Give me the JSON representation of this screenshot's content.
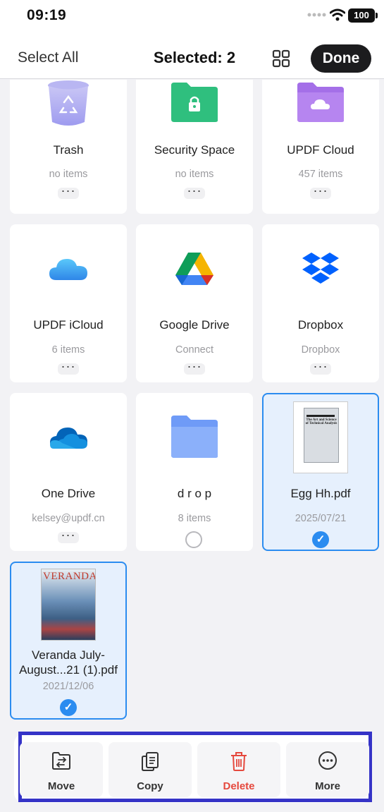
{
  "status_bar": {
    "time": "09:19",
    "battery": "100"
  },
  "nav": {
    "select_all": "Select All",
    "selected": "Selected: 2",
    "done": "Done"
  },
  "items": [
    {
      "name": "Trash",
      "sub": "no items",
      "icon": "trash-icon",
      "selected": false
    },
    {
      "name": "Security Space",
      "sub": "no items",
      "icon": "security-folder-icon",
      "selected": false
    },
    {
      "name": "UPDF Cloud",
      "sub": "457 items",
      "icon": "cloud-folder-icon",
      "selected": false
    },
    {
      "name": "UPDF iCloud",
      "sub": "6 items",
      "icon": "icloud-icon",
      "selected": false
    },
    {
      "name": "Google Drive",
      "sub": "Connect",
      "icon": "google-drive-icon",
      "selected": false
    },
    {
      "name": "Dropbox",
      "sub": "Dropbox",
      "icon": "dropbox-icon",
      "selected": false
    },
    {
      "name": "One Drive",
      "sub": "kelsey@updf.cn",
      "icon": "onedrive-icon",
      "selected": false
    },
    {
      "name": "d r o p",
      "sub": "8 items",
      "icon": "folder-icon",
      "selected": false
    },
    {
      "name": "Egg Hh.pdf",
      "sub": "2025/07/21",
      "icon": "pdf-thumbnail",
      "selected": true,
      "thumb_text": "The Art and Science of Technical Analysis"
    },
    {
      "name": "Veranda July-August...21 (1).pdf",
      "sub": "2021/12/06",
      "icon": "magazine-thumbnail",
      "selected": true,
      "thumb_text": "VERANDA"
    }
  ],
  "toolbar": {
    "move": "Move",
    "copy": "Copy",
    "delete": "Delete",
    "more": "More"
  },
  "colors": {
    "accent": "#2b8cf0",
    "delete": "#e5483d",
    "highlight_frame": "#3533c7"
  }
}
